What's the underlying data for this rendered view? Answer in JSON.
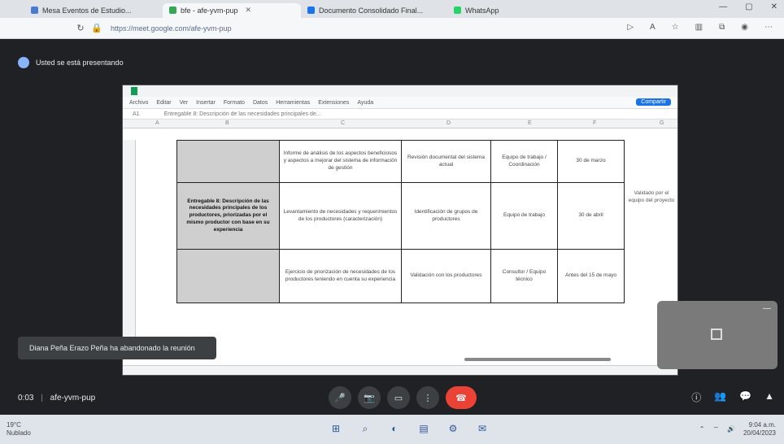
{
  "browser": {
    "tabs": [
      {
        "label": "Mesa Eventos de Estudio..."
      },
      {
        "label": "bfe - afe-yvm-pup"
      },
      {
        "label": "Documento Consolidado Final..."
      },
      {
        "label": "WhatsApp"
      }
    ],
    "url": "https://meet.google.com/afe-yvm-pup",
    "window_controls": [
      "—",
      "▢",
      "✕"
    ]
  },
  "meet": {
    "presenting_banner": "Usted se está presentando",
    "toast": "Diana Peña Erazo Peña ha abandonado la reunión",
    "meeting_time": "0:03",
    "meeting_code": "afe-yvm-pup",
    "controls": [
      "🎤",
      "📷",
      "▭",
      "⋮",
      "☎"
    ],
    "right_controls": [
      "ⓘ",
      "👥",
      "💬",
      "▲"
    ]
  },
  "shared_sheet": {
    "menu": [
      "Archivo",
      "Editar",
      "Ver",
      "Insertar",
      "Formato",
      "Datos",
      "Herramientas",
      "Extensiones",
      "Ayuda"
    ],
    "share_label": "Compartir",
    "formula_cell": "A1",
    "formula_text": "Entregable 8: Descripción de las necesidades principales de...",
    "columns": [
      "A",
      "B",
      "C",
      "D",
      "E",
      "F",
      "G"
    ],
    "rows": [
      {
        "c1": "",
        "c2": "Informe de análisis de los aspectos beneficiosos y aspectos a mejorar del sistema de información de gestión",
        "c3": "Revisión documental del sistema actual",
        "c4": "Equipo de trabajo / Coordinación",
        "c5": "30 de marzo"
      },
      {
        "c1": "Entregable 8: Descripción de las necesidades principales de los productores, priorizadas por el mismo productor con base en su experiencia",
        "c2": "Levantamiento de necesidades y requerimientos de los productores (caracterización)",
        "c3": "Identificación de grupos de productores",
        "c4": "Equipo de trabajo",
        "c5": "30 de abril"
      },
      {
        "c1": "",
        "c2": "Ejercicio de priorización de necesidades de los productores teniendo en cuenta su experiencia",
        "c3": "Validación con los productores",
        "c4": "Consultor / Equipo técnico",
        "c5": "Antes del 15 de mayo"
      }
    ],
    "side_note": "Validado por el equipo del proyecto"
  },
  "taskbar": {
    "weather_temp": "19°C",
    "weather_desc": "Nublado",
    "apps": [
      "⊞",
      "⌕",
      "◐",
      "▤",
      "⚙",
      "✉"
    ],
    "time": "9:04 a.m.",
    "date": "20/04/2023"
  }
}
